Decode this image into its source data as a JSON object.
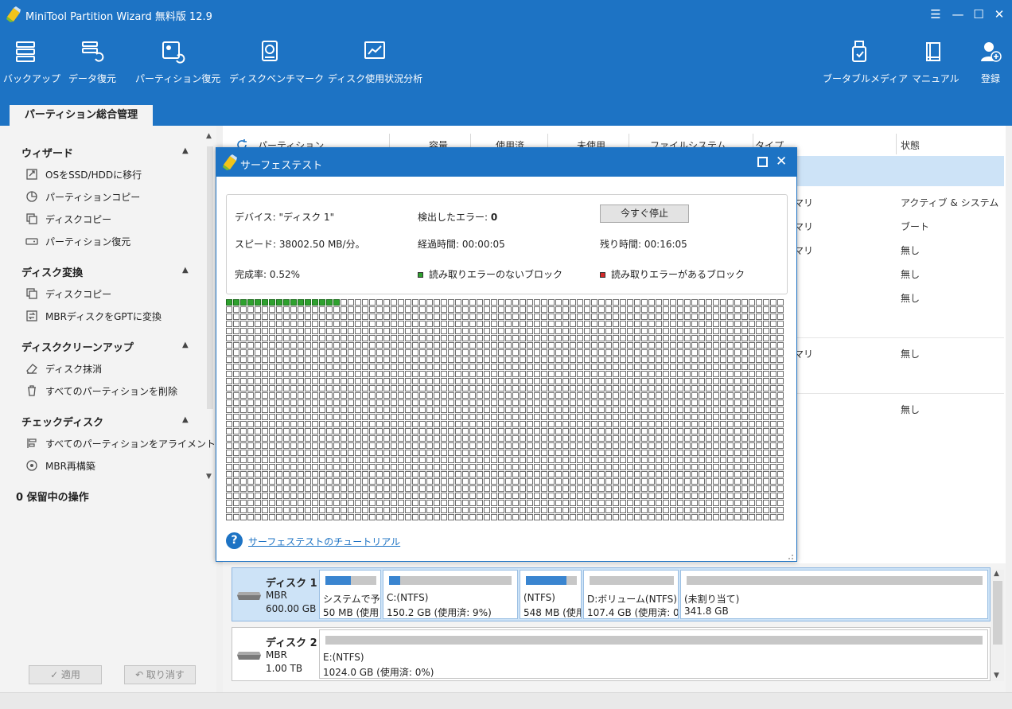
{
  "app": {
    "title": "MiniTool Partition Wizard 無料版 12.9"
  },
  "window_controls": {
    "menu": "☰",
    "minimize": "—",
    "maximize": "☐",
    "close": "✕"
  },
  "toolbar": {
    "items": [
      {
        "label": "バックアップ",
        "icon": "backup-icon"
      },
      {
        "label": "データ復元",
        "icon": "data-recovery-icon"
      },
      {
        "label": "パーティション復元",
        "icon": "partition-recovery-icon"
      },
      {
        "label": "ディスクベンチマーク",
        "icon": "disk-benchmark-icon"
      },
      {
        "label": "ディスク使用状況分析",
        "icon": "space-analyzer-icon"
      },
      {
        "label": "ブータブルメディア",
        "icon": "bootable-media-icon"
      },
      {
        "label": "マニュアル",
        "icon": "manual-icon"
      },
      {
        "label": "登録",
        "icon": "register-icon"
      }
    ]
  },
  "tabs": {
    "active": "パーティション総合管理"
  },
  "sidebar": {
    "sections": [
      {
        "title": "ウィザード",
        "items": [
          "OSをSSD/HDDに移行",
          "パーティションコピー",
          "ディスクコピー",
          "パーティション復元"
        ]
      },
      {
        "title": "ディスク変換",
        "items": [
          "ディスクコピー",
          "MBRディスクをGPTに変換"
        ]
      },
      {
        "title": "ディスククリーンアップ",
        "items": [
          "ディスク抹消",
          "すべてのパーティションを削除"
        ]
      },
      {
        "title": "チェックディスク",
        "items": [
          "すべてのパーティションをアライメント",
          "MBR再構築"
        ]
      }
    ],
    "pending": "0 保留中の操作",
    "apply": "✓ 適用",
    "undo": "↶ 取り消す"
  },
  "table": {
    "headers": [
      "パーティション",
      "容量",
      "使用済",
      "未使用",
      "ファイルシステム",
      "タイプ",
      "状態"
    ],
    "type_cells": [
      "マリ",
      "マリ",
      "マリ",
      "マリ"
    ],
    "status_cells": [
      "アクティブ & システム",
      "ブート",
      "無し",
      "無し",
      "無し",
      "無し",
      "無し"
    ]
  },
  "disks": [
    {
      "name": "ディスク 1",
      "type": "MBR",
      "size": "600.00 GB",
      "partitions": [
        {
          "line1": "システムで予約",
          "line2": "50 MB (使用",
          "used": 0.5
        },
        {
          "line1": "C:(NTFS)",
          "line2": "150.2 GB (使用済: 9%)",
          "used": 0.09
        },
        {
          "line1": "(NTFS)",
          "line2": "548 MB (使用",
          "used": 0.8
        },
        {
          "line1": "D:ボリューム(NTFS)",
          "line2": "107.4 GB (使用済: 0",
          "used": 0
        },
        {
          "line1": "(未割り当て)",
          "line2": "341.8 GB",
          "used": 0
        }
      ]
    },
    {
      "name": "ディスク 2",
      "type": "MBR",
      "size": "1.00 TB",
      "partitions": [
        {
          "line1": "E:(NTFS)",
          "line2": "1024.0 GB (使用済: 0%)",
          "used": 0
        }
      ]
    }
  ],
  "dialog": {
    "title": "サーフェステスト",
    "device_label": "デバイス:",
    "device_value": "\"ディスク 1\"",
    "errors_label": "検出したエラー:",
    "errors_value": "0",
    "stop_button": "今すぐ停止",
    "speed_label": "スピード:",
    "speed_value": "38002.50 MB/分。",
    "elapsed_label": "経過時間:",
    "elapsed_value": "00:00:05",
    "remaining_label": "残り時間:",
    "remaining_value": "00:16:05",
    "progress_label": "完成率:",
    "progress_value": "0.52%",
    "legend_ok": "読み取りエラーのないブロック",
    "legend_err": "読み取りエラーがあるブロック",
    "help_link": "サーフェステストのチュートリアル",
    "grid": {
      "cols": 78,
      "rows": 31,
      "scanned": 16
    }
  },
  "colors": {
    "brand_blue": "#1d73c4",
    "selection": "#cde3f7",
    "ok_block": "#2ea12e",
    "err_block": "#d42a2a",
    "used_bar": "#3a85d0"
  }
}
